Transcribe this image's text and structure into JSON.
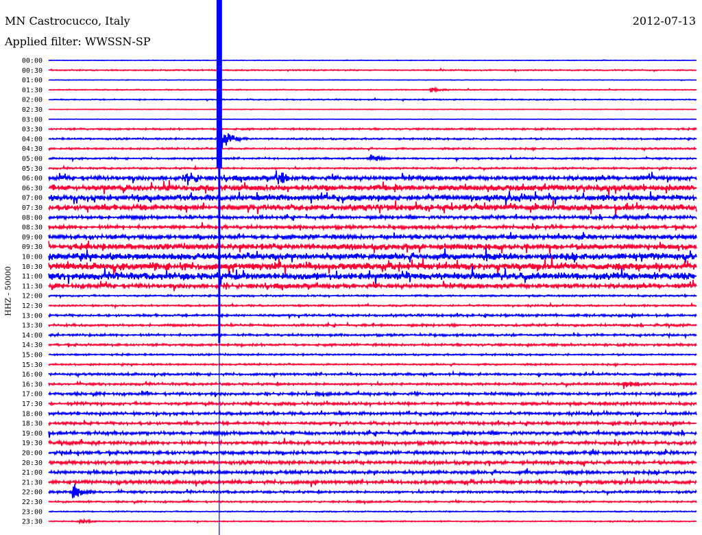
{
  "header": {
    "station": "MN Castrocucco, Italy",
    "filter": "Applied filter: WWSSN-SP",
    "date": "2012-07-13"
  },
  "chart_data": {
    "type": "line",
    "title": "MN Castrocucco, Italy",
    "ylabel": "HHZ - 50000",
    "minutes_per_row": 30,
    "colors": [
      "#0000ff",
      "#ff0033"
    ],
    "rows": [
      "00:00",
      "00:30",
      "01:00",
      "01:30",
      "02:00",
      "02:30",
      "03:00",
      "03:30",
      "04:00",
      "04:30",
      "05:00",
      "05:30",
      "06:00",
      "06:30",
      "07:00",
      "07:30",
      "08:00",
      "08:30",
      "09:00",
      "09:30",
      "10:00",
      "10:30",
      "11:00",
      "11:30",
      "12:00",
      "12:30",
      "13:00",
      "13:30",
      "14:00",
      "14:30",
      "15:00",
      "15:30",
      "16:00",
      "16:30",
      "17:00",
      "17:30",
      "18:00",
      "18:30",
      "19:00",
      "19:30",
      "20:00",
      "20:30",
      "21:00",
      "21:30",
      "22:00",
      "22:30",
      "23:00",
      "23:30"
    ],
    "noise_amplitude": [
      0.5,
      1,
      0.5,
      0.8,
      1,
      0.5,
      0.5,
      1.5,
      1.5,
      1.5,
      1.5,
      1.5,
      4,
      5,
      5,
      5,
      3,
      3,
      4,
      5,
      6,
      6,
      6,
      4,
      1.5,
      1.5,
      2,
      2,
      2,
      2,
      1.5,
      1.5,
      2,
      2,
      2.5,
      2.5,
      2.5,
      2.5,
      3,
      3,
      3,
      3,
      3,
      3,
      2,
      1.5,
      1,
      1
    ],
    "events": [
      {
        "row": "01:30",
        "minute": 17.7,
        "amplitude": 4
      },
      {
        "row": "04:00",
        "minute": 7.9,
        "amplitude": 20
      },
      {
        "row": "05:00",
        "minute": 14.9,
        "amplitude": 7
      },
      {
        "row": "06:00",
        "minute": 6.5,
        "amplitude": 12
      },
      {
        "row": "06:00",
        "minute": 10.6,
        "amplitude": 14
      },
      {
        "row": "16:30",
        "minute": 26.7,
        "amplitude": 9
      },
      {
        "row": "22:00",
        "minute": 1.2,
        "amplitude": 12
      },
      {
        "row": "23:30",
        "minute": 1.5,
        "amplitude": 4
      }
    ],
    "mainshock": {
      "row": "00:00",
      "minute": 7.9
    }
  }
}
